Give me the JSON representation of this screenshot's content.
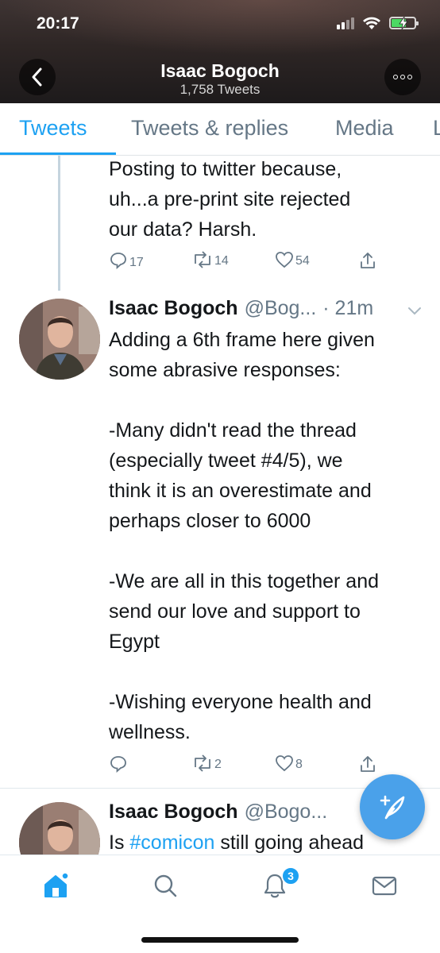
{
  "status_bar": {
    "time": "20:17"
  },
  "header": {
    "title": "Isaac Bogoch",
    "subtitle": "1,758 Tweets"
  },
  "tabs": [
    {
      "label": "Tweets",
      "active": true
    },
    {
      "label": "Tweets & replies",
      "active": false
    },
    {
      "label": "Media",
      "active": false
    },
    {
      "label": "L",
      "active": false
    }
  ],
  "tweets": [
    {
      "text": "Posting to twitter because,\nuh...a pre-print site rejected\nour data? Harsh.",
      "replies": "17",
      "retweets": "14",
      "likes": "54"
    },
    {
      "name": "Isaac Bogoch",
      "handle": "@Bog...",
      "time": "· 21m",
      "text": "Adding a 6th frame here given\nsome abrasive responses:\n\n-Many didn't read the thread\n(especially tweet #4/5), we\nthink it is an overestimate and\nperhaps closer to 6000\n\n-We are all in this together and\nsend our love and support to\nEgypt\n\n-Wishing everyone health and\nwellness.",
      "replies": "",
      "retweets": "2",
      "likes": "8"
    },
    {
      "name": "Isaac Bogoch",
      "handle": "@Bogo...",
      "text_before": "Is ",
      "hashtag": "#comicon",
      "text_after": " still going ahead"
    }
  ],
  "bottom_nav": {
    "items": [
      "home-icon",
      "search-icon",
      "notifications-icon",
      "messages-icon"
    ],
    "notification_count": "3"
  },
  "colors": {
    "accent": "#1da1f2",
    "muted": "#657786"
  }
}
